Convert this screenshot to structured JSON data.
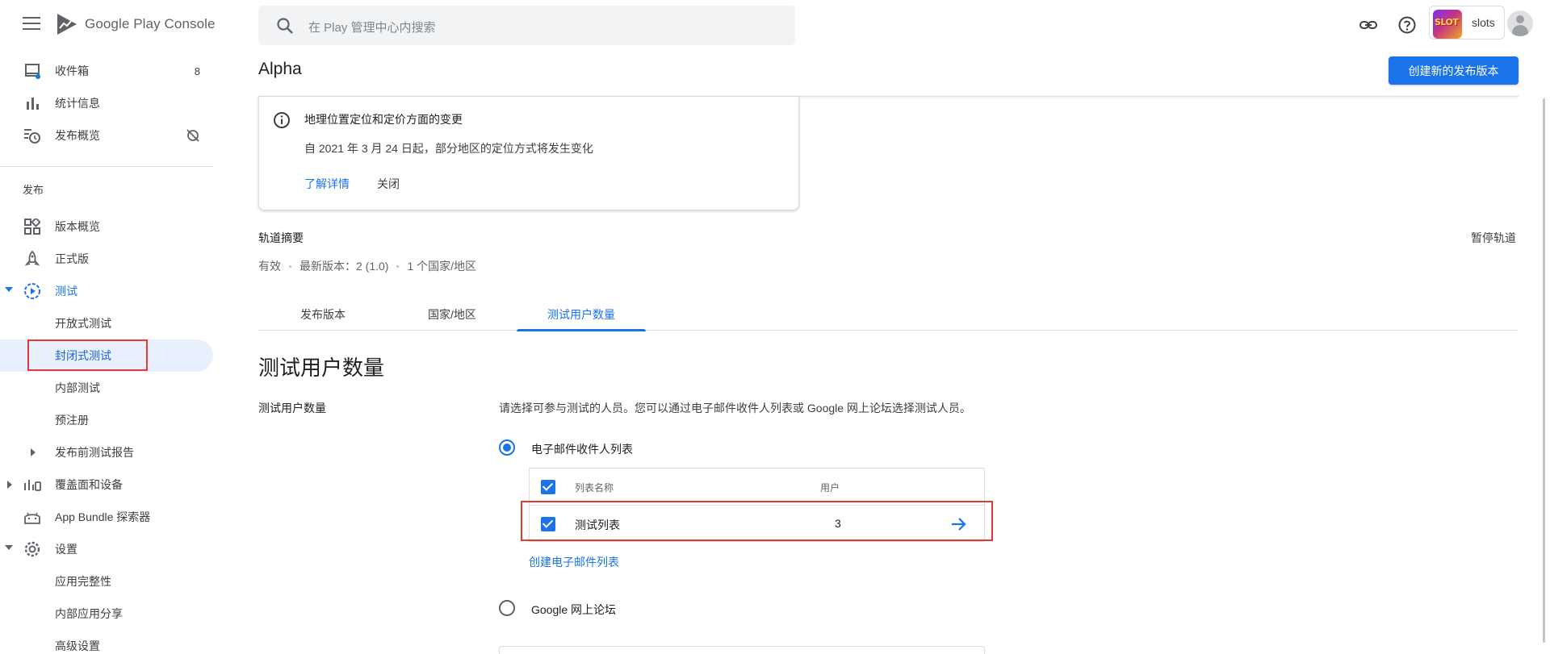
{
  "app": {
    "brand": "Google Play Console"
  },
  "search": {
    "placeholder": "在 Play 管理中心内搜索"
  },
  "account": {
    "app_name": "slots",
    "thumb_text": "SLOT"
  },
  "sidebar": {
    "inbox": {
      "label": "收件箱",
      "count": "8"
    },
    "stats": {
      "label": "统计信息"
    },
    "publishing_overview": {
      "label": "发布概览"
    },
    "section_release": "发布",
    "release_overview": {
      "label": "版本概览"
    },
    "production": {
      "label": "正式版"
    },
    "testing": {
      "label": "测试"
    },
    "open_testing": {
      "label": "开放式测试"
    },
    "closed_testing": {
      "label": "封闭式测试"
    },
    "internal_testing": {
      "label": "内部测试"
    },
    "pre_registration": {
      "label": "预注册"
    },
    "pre_launch_report": {
      "label": "发布前测试报告"
    },
    "reach_devices": {
      "label": "覆盖面和设备"
    },
    "bundle_explorer": {
      "label": "App Bundle 探索器"
    },
    "setup": {
      "label": "设置"
    },
    "app_integrity": {
      "label": "应用完整性"
    },
    "internal_sharing": {
      "label": "内部应用分享"
    },
    "advanced_settings": {
      "label": "高级设置"
    }
  },
  "header": {
    "title": "Alpha",
    "create_release": "创建新的发布版本"
  },
  "notice": {
    "title": "地理位置定位和定价方面的变更",
    "body": "自 2021 年 3 月 24 日起，部分地区的定位方式将发生变化",
    "learn_more": "了解详情",
    "close": "关闭"
  },
  "track": {
    "summary_title": "轨道摘要",
    "pause": "暂停轨道",
    "status": "有效",
    "latest_version": "最新版本：2 (1.0)",
    "countries": "1 个国家/地区"
  },
  "tabs": [
    {
      "label": "发布版本"
    },
    {
      "label": "国家/地区"
    },
    {
      "label": "测试用户数量"
    }
  ],
  "testers": {
    "section_title": "测试用户数量",
    "field_label": "测试用户数量",
    "description": "请选择可参与测试的人员。您可以通过电子邮件收件人列表或 Google 网上论坛选择测试人员。",
    "option_email": "电子邮件收件人列表",
    "option_groups": "Google 网上论坛",
    "table": {
      "col_name": "列表名称",
      "col_users": "用户",
      "rows": [
        {
          "name": "测试列表",
          "users": "3"
        }
      ]
    },
    "create_list": "创建电子邮件列表"
  },
  "colors": {
    "accent": "#1a73e8",
    "highlight": "#e53935",
    "selected_bg": "#e8f0fe"
  }
}
